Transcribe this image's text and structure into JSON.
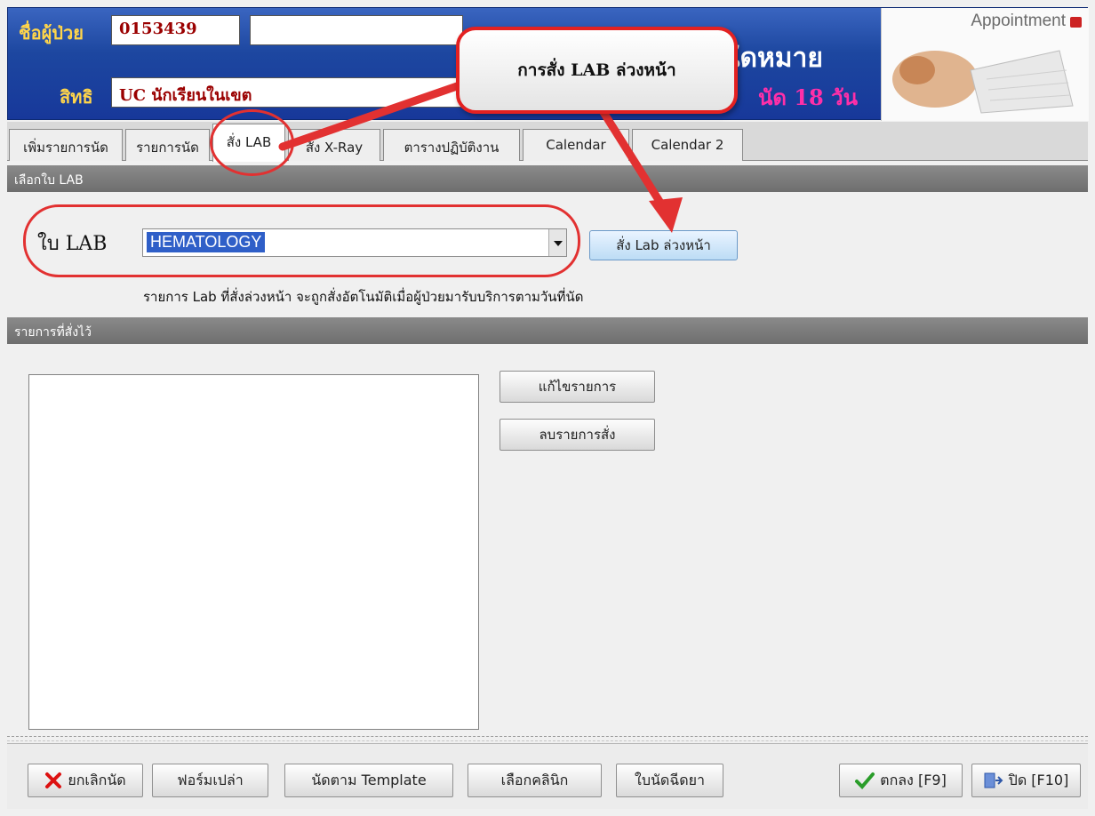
{
  "header": {
    "patient_label": "ชื่อผู้ป่วย",
    "patient_id": "0153439",
    "patient_name": "",
    "rights_label": "สิทธิ",
    "rights_value": "UC นักเรียนในเขต",
    "appointment_title": "นัดหมาย",
    "appointment_days": "นัด 18 วัน",
    "banner_text": "Appointment"
  },
  "callout": {
    "text": "การสั่ง LAB ล่วงหน้า"
  },
  "tabs": [
    {
      "label": "เพิ่มรายการนัด"
    },
    {
      "label": "รายการนัด"
    },
    {
      "label": "สั่ง LAB"
    },
    {
      "label": "สั่ง X-Ray"
    },
    {
      "label": "ตารางปฏิบัติงาน"
    },
    {
      "label": "Calendar"
    },
    {
      "label": "Calendar 2"
    }
  ],
  "lab_section": {
    "title": "เลือกใบ LAB",
    "field_label": "ใบ LAB",
    "selected_value": "HEMATOLOGY",
    "order_button": "สั่ง Lab ล่วงหน้า",
    "note": "รายการ Lab ที่สั่งล่วงหน้า จะถูกสั่งอัตโนมัติเมื่อผู้ป่วยมารับบริการตามวันที่นัด"
  },
  "ordered_section": {
    "title": "รายการที่สั่งไว้",
    "edit_button": "แก้ไขรายการ",
    "delete_button": "ลบรายการสั่ง"
  },
  "bottom_bar": {
    "cancel": "ยกเลิกนัด",
    "blank_form": "ฟอร์มเปล่า",
    "template": "นัดตาม Template",
    "clinic": "เลือกคลินิก",
    "injection": "ใบนัดฉีดยา",
    "ok": "ตกลง [F9]",
    "close": "ปิด [F10]"
  },
  "colors": {
    "header_blue": "#1d47a0",
    "label_yellow": "#ffd54a",
    "highlight_red": "#e23131",
    "days_pink": "#ff2fa8"
  }
}
